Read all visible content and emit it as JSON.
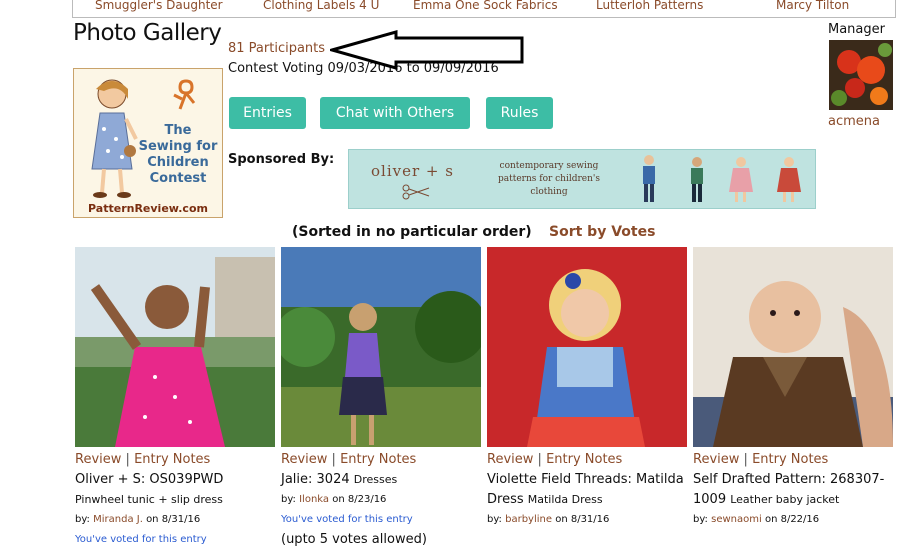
{
  "top_nav": {
    "items": [
      "Smuggler's Daughter",
      "Clothing Labels 4 U",
      "Emma One Sock Fabrics",
      "Lutterloh Patterns",
      "Marcy Tilton"
    ]
  },
  "page_title": "Photo Gallery",
  "participants_link": "81 Participants",
  "voting_dates": "Contest Voting 09/03/2016 to 09/09/2016",
  "contest_logo": {
    "title_lines": [
      "The",
      "Sewing for",
      "Children",
      "Contest"
    ],
    "site": "PatternReview.com"
  },
  "buttons": {
    "entries": "Entries",
    "chat": "Chat with Others",
    "rules": "Rules"
  },
  "sponsored_label": "Sponsored By:",
  "sponsor_banner": {
    "brand": "oliver + s",
    "tagline": "contemporary sewing patterns for children's clothing"
  },
  "manager": {
    "label": "Manager",
    "name": "acmena"
  },
  "sort": {
    "note": "(Sorted in no particular order)",
    "link": "Sort by Votes"
  },
  "entries": [
    {
      "review": "Review",
      "notes": "Entry Notes",
      "title": "Oliver + S: OS039PWD",
      "subtitle": "Pinwheel tunic + slip dress",
      "by": "by:",
      "user": "Miranda J.",
      "date": "on 8/31/16",
      "voted": "You've voted for this entry",
      "allowed": ""
    },
    {
      "review": "Review",
      "notes": "Entry Notes",
      "title": "Jalie: 3024",
      "subtitle": "Dresses",
      "by": "by:",
      "user": "Ilonka",
      "date": "on 8/23/16",
      "voted": "You've voted for this entry",
      "allowed": "(upto 5 votes allowed)"
    },
    {
      "review": "Review",
      "notes": "Entry Notes",
      "title": "Violette Field Threads: Matilda Dress",
      "subtitle": "Matilda Dress",
      "by": "by:",
      "user": "barbyline",
      "date": "on 8/31/16",
      "voted": "",
      "allowed": ""
    },
    {
      "review": "Review",
      "notes": "Entry Notes",
      "title": "Self Drafted Pattern: 268307-1009",
      "subtitle": "Leather baby jacket",
      "by": "by:",
      "user": "sewnaomi",
      "date": "on 8/22/16",
      "voted": "",
      "allowed": ""
    }
  ],
  "colors": {
    "accent_button": "#3dbda5",
    "link": "#8a4b2a",
    "voted_link": "#2a5bd1"
  }
}
